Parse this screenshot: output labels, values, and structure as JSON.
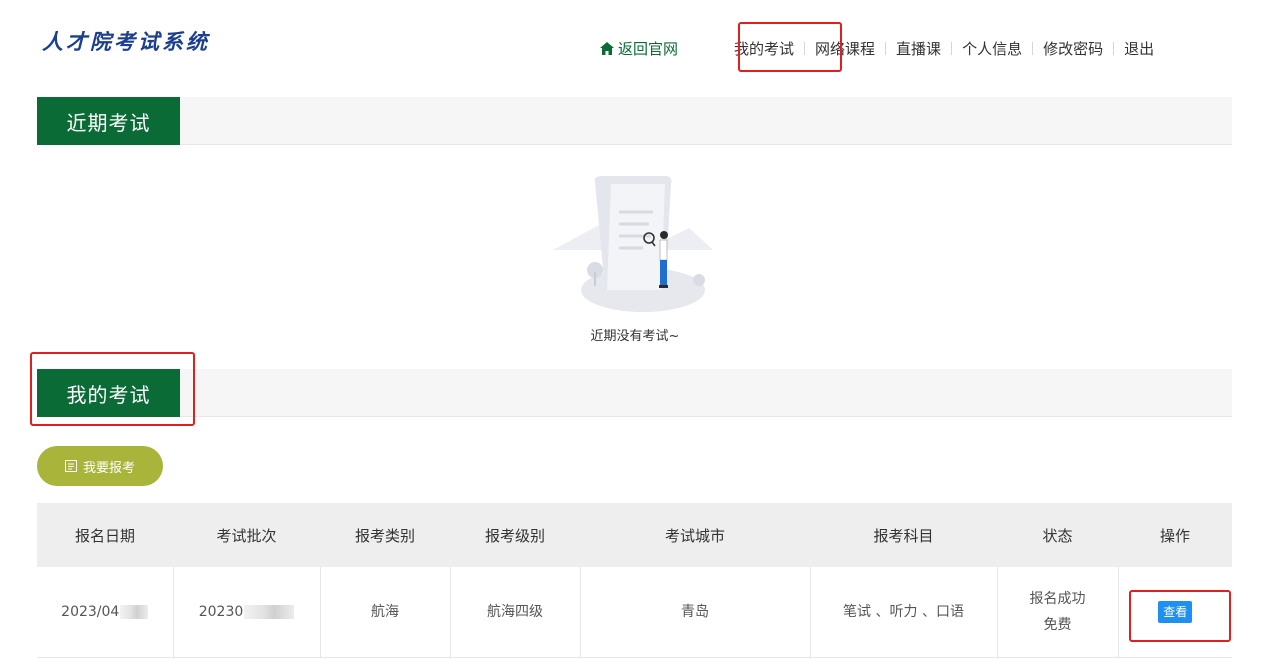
{
  "app": {
    "logo_text": "人才院考试系统"
  },
  "nav": {
    "home": "返回官网",
    "items": [
      "我的考试",
      "网络课程",
      "直播课",
      "个人信息",
      "修改密码",
      "退出"
    ]
  },
  "recent": {
    "title": "近期考试",
    "empty_text": "近期没有考试~"
  },
  "my_exams": {
    "title": "我的考试",
    "register_label": "我要报考",
    "columns": [
      "报名日期",
      "考试批次",
      "报考类别",
      "报考级别",
      "考试城市",
      "报考科目",
      "状态",
      "操作"
    ],
    "rows": [
      {
        "date": "2023/04",
        "batch": "20230",
        "category": "航海",
        "level": "航海四级",
        "city": "青岛",
        "subjects": "笔试 、听力 、口语",
        "status": "报名成功",
        "fee": "免费",
        "action": "查看"
      }
    ]
  },
  "colors": {
    "primary_green": "#0b6b36",
    "register_olive": "#a9b43a",
    "view_blue": "#1f8ff0",
    "highlight_red": "#e02020"
  }
}
